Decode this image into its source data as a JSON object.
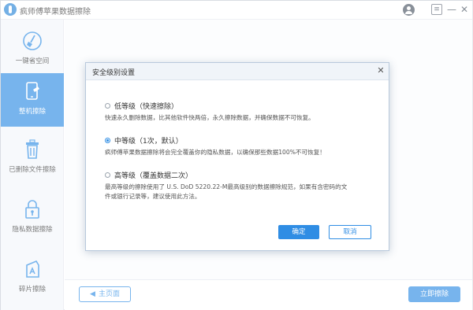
{
  "app": {
    "title": "疯师傅苹果数据擦除",
    "menu_glyph": "≡",
    "minimize_glyph": "—",
    "close_glyph": "✕"
  },
  "sidebar": {
    "items": [
      {
        "label": "一键省空间",
        "icon": "broom-icon",
        "active": false
      },
      {
        "label": "整机擦除",
        "icon": "phone-erase-icon",
        "active": true
      },
      {
        "label": "已删除文件擦除",
        "icon": "trash-icon",
        "active": false
      },
      {
        "label": "隐私数据擦除",
        "icon": "lock-icon",
        "active": false
      },
      {
        "label": "碎片擦除",
        "icon": "fragment-icon",
        "active": false
      }
    ]
  },
  "main": {
    "home_button": "主页面",
    "erase_button": "立即擦除"
  },
  "dialog": {
    "title": "安全级别设置",
    "close_glyph": "✕",
    "options": [
      {
        "label": "低等级（快速擦除）",
        "desc": "快速永久删除数据，比其他软件快两倍，永久擦除数据，并确保数据不可恢复。",
        "checked": false
      },
      {
        "label": "中等级（1次，默认）",
        "desc": "疯师傅苹果数据擦除将会完全覆盖你的隐私数据，以确保那些数据100%不可恢复！",
        "checked": true
      },
      {
        "label": "高等级（覆盖数据二次）",
        "desc": "最高等级的擦除使用了 U.S. DoD 5220.22-M最高级别的数据擦除规范，如果有含密码的文件或银行记录等，建议使用此方法。",
        "checked": false
      }
    ],
    "ok_button": "确定",
    "cancel_button": "取消"
  },
  "colors": {
    "accent": "#2f8de4",
    "sidebar_bg": "#f3f6fa",
    "dialog_header_bg": "#f0f4f9"
  }
}
